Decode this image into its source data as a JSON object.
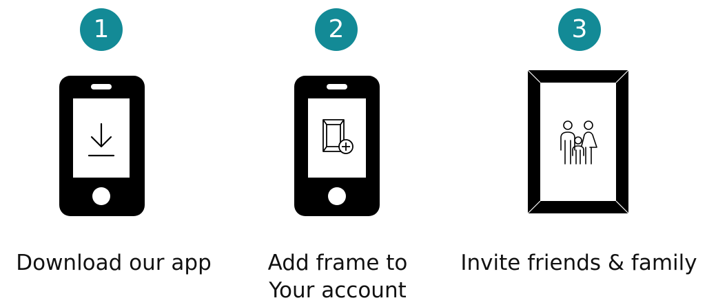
{
  "theme": {
    "accent": "#138a96",
    "ink": "#000000",
    "paper": "#ffffff"
  },
  "steps": [
    {
      "number": "1",
      "icon": "download-icon",
      "device": "phone",
      "caption": [
        "Download our app"
      ]
    },
    {
      "number": "2",
      "icon": "add-frame-icon",
      "device": "phone",
      "caption": [
        "Add frame to",
        "Your account"
      ]
    },
    {
      "number": "3",
      "icon": "family-icon",
      "device": "photo-frame",
      "caption": [
        "Invite friends & family"
      ]
    }
  ]
}
